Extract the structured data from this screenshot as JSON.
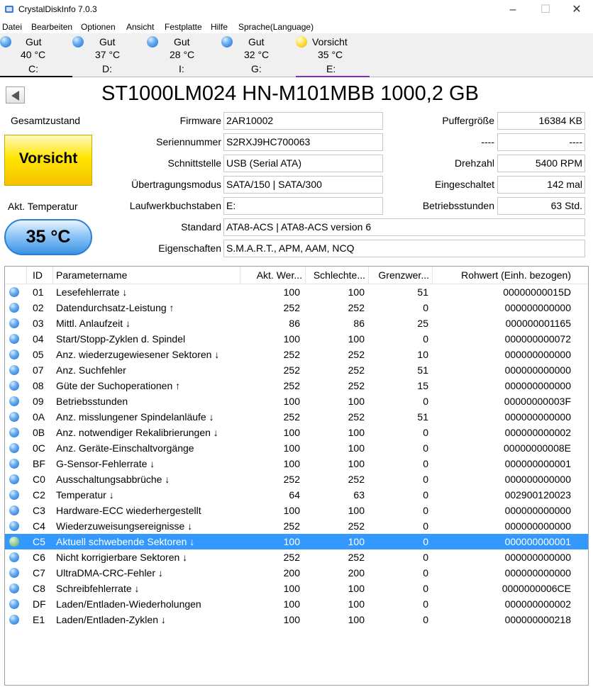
{
  "window": {
    "title": "CrystalDiskInfo 7.0.3",
    "min": "–",
    "max": "☐",
    "close": "✕"
  },
  "menu": [
    "Datei",
    "Bearbeiten",
    "Optionen",
    "Ansicht",
    "Festplatte",
    "Hilfe",
    "Sprache(Language)"
  ],
  "drives": [
    {
      "status": "Gut",
      "temp": "40 °C",
      "letter": "C:",
      "level": "good"
    },
    {
      "status": "Gut",
      "temp": "37 °C",
      "letter": "D:",
      "level": "good"
    },
    {
      "status": "Gut",
      "temp": "28 °C",
      "letter": "I:",
      "level": "good"
    },
    {
      "status": "Gut",
      "temp": "32 °C",
      "letter": "G:",
      "level": "good"
    },
    {
      "status": "Vorsicht",
      "temp": "35 °C",
      "letter": "E:",
      "level": "caution"
    }
  ],
  "colors": {
    "selected_tab_underline_c": "#000000",
    "selected_tab_underline_e": "#7b2fbf",
    "selection": "#3399ff",
    "caution": "#ffe600"
  },
  "disk": {
    "title": "ST1000LM024 HN-M101MBB 1000,2 GB",
    "health_label": "Gesamtzustand",
    "health_value": "Vorsicht",
    "temp_label": "Akt. Temperatur",
    "temp_value": "35 °C",
    "labels": {
      "firmware": "Firmware",
      "serial": "Seriennummer",
      "interface": "Schnittstelle",
      "transfer": "Übertragungsmodus",
      "drive_letters": "Laufwerkbuchstaben",
      "standard": "Standard",
      "features": "Eigenschaften",
      "buffer": "Puffergröße",
      "unknown": "----",
      "rotation": "Drehzahl",
      "power_count": "Eingeschaltet",
      "power_hours": "Betriebsstunden"
    },
    "values": {
      "firmware": "2AR10002",
      "serial": "S2RXJ9HC700063",
      "interface": "USB (Serial ATA)",
      "transfer": "SATA/150 | SATA/300",
      "drive_letters": "E:",
      "standard": "ATA8-ACS | ATA8-ACS version 6",
      "features": "S.M.A.R.T., APM, AAM, NCQ",
      "buffer": "16384 KB",
      "unknown": "----",
      "rotation": "5400 RPM",
      "power_count": "142 mal",
      "power_hours": "63 Std."
    }
  },
  "table": {
    "headers": [
      "ID",
      "Parametername",
      "Akt. Wer...",
      "Schlechte...",
      "Grenzwer...",
      "Rohwert (Einh. bezogen)"
    ],
    "rows": [
      {
        "id": "01",
        "name": "Lesefehlerrate ↓",
        "cur": "100",
        "worst": "100",
        "thr": "51",
        "raw": "00000000015D"
      },
      {
        "id": "02",
        "name": "Datendurchsatz-Leistung ↑",
        "cur": "252",
        "worst": "252",
        "thr": "0",
        "raw": "000000000000"
      },
      {
        "id": "03",
        "name": "Mittl. Anlaufzeit ↓",
        "cur": "86",
        "worst": "86",
        "thr": "25",
        "raw": "000000001165"
      },
      {
        "id": "04",
        "name": "Start/Stopp-Zyklen d. Spindel",
        "cur": "100",
        "worst": "100",
        "thr": "0",
        "raw": "000000000072"
      },
      {
        "id": "05",
        "name": "Anz. wiederzugewiesener Sektoren ↓",
        "cur": "252",
        "worst": "252",
        "thr": "10",
        "raw": "000000000000"
      },
      {
        "id": "07",
        "name": "Anz. Suchfehler",
        "cur": "252",
        "worst": "252",
        "thr": "51",
        "raw": "000000000000"
      },
      {
        "id": "08",
        "name": "Güte der Suchoperationen ↑",
        "cur": "252",
        "worst": "252",
        "thr": "15",
        "raw": "000000000000"
      },
      {
        "id": "09",
        "name": "Betriebsstunden",
        "cur": "100",
        "worst": "100",
        "thr": "0",
        "raw": "00000000003F"
      },
      {
        "id": "0A",
        "name": "Anz. misslungener Spindelanläufe ↓",
        "cur": "252",
        "worst": "252",
        "thr": "51",
        "raw": "000000000000"
      },
      {
        "id": "0B",
        "name": "Anz. notwendiger Rekalibrierungen ↓",
        "cur": "100",
        "worst": "100",
        "thr": "0",
        "raw": "000000000002"
      },
      {
        "id": "0C",
        "name": "Anz. Geräte-Einschaltvorgänge",
        "cur": "100",
        "worst": "100",
        "thr": "0",
        "raw": "00000000008E"
      },
      {
        "id": "BF",
        "name": "G-Sensor-Fehlerrate ↓",
        "cur": "100",
        "worst": "100",
        "thr": "0",
        "raw": "000000000001"
      },
      {
        "id": "C0",
        "name": "Ausschaltungsabbrüche ↓",
        "cur": "252",
        "worst": "252",
        "thr": "0",
        "raw": "000000000000"
      },
      {
        "id": "C2",
        "name": "Temperatur ↓",
        "cur": "64",
        "worst": "63",
        "thr": "0",
        "raw": "002900120023"
      },
      {
        "id": "C3",
        "name": "Hardware-ECC wiederhergestellt",
        "cur": "100",
        "worst": "100",
        "thr": "0",
        "raw": "000000000000"
      },
      {
        "id": "C4",
        "name": "Wiederzuweisungsereignisse ↓",
        "cur": "252",
        "worst": "252",
        "thr": "0",
        "raw": "000000000000"
      },
      {
        "id": "C5",
        "name": "Aktuell schwebende Sektoren ↓",
        "cur": "100",
        "worst": "100",
        "thr": "0",
        "raw": "000000000001",
        "selected": true
      },
      {
        "id": "C6",
        "name": "Nicht korrigierbare Sektoren ↓",
        "cur": "252",
        "worst": "252",
        "thr": "0",
        "raw": "000000000000"
      },
      {
        "id": "C7",
        "name": "UltraDMA-CRC-Fehler ↓",
        "cur": "200",
        "worst": "200",
        "thr": "0",
        "raw": "000000000000"
      },
      {
        "id": "C8",
        "name": "Schreibfehlerrate ↓",
        "cur": "100",
        "worst": "100",
        "thr": "0",
        "raw": "0000000006CE"
      },
      {
        "id": "DF",
        "name": "Laden/Entladen-Wiederholungen",
        "cur": "100",
        "worst": "100",
        "thr": "0",
        "raw": "000000000002"
      },
      {
        "id": "E1",
        "name": "Laden/Entladen-Zyklen ↓",
        "cur": "100",
        "worst": "100",
        "thr": "0",
        "raw": "000000000218"
      }
    ]
  }
}
